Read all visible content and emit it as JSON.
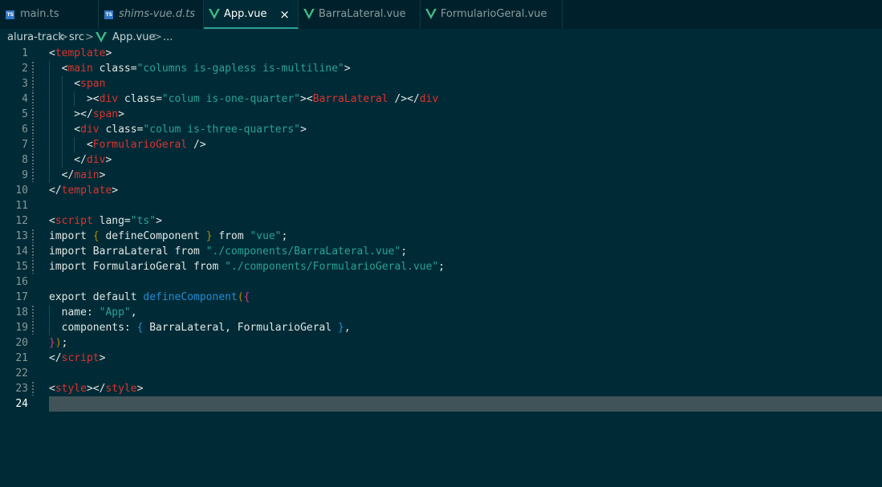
{
  "tabs": [
    {
      "label": "main.ts",
      "icon": "typescript-icon",
      "active": false,
      "italic": false
    },
    {
      "label": "shims-vue.d.ts",
      "icon": "typescript-icon",
      "active": false,
      "italic": true
    },
    {
      "label": "App.vue",
      "icon": "vue-icon",
      "active": true,
      "italic": false,
      "close": "×"
    },
    {
      "label": "BarraLateral.vue",
      "icon": "vue-icon",
      "active": false,
      "italic": false
    },
    {
      "label": "FormularioGeral.vue",
      "icon": "vue-icon",
      "active": false,
      "italic": false
    }
  ],
  "breadcrumb": {
    "items": [
      "alura-track",
      "src",
      "App.vue",
      "..."
    ],
    "separator": ">"
  },
  "editor": {
    "current_line": 24,
    "lines": [
      [
        [
          "p",
          "<"
        ],
        [
          "t",
          "template"
        ],
        [
          "p",
          ">"
        ]
      ],
      [
        [
          "p",
          "  <"
        ],
        [
          "t",
          "main"
        ],
        [
          "a",
          " class="
        ],
        [
          "s",
          "\"columns is-gapless is-multiline\""
        ],
        [
          "p",
          ">"
        ]
      ],
      [
        [
          "p",
          "    <"
        ],
        [
          "t",
          "span"
        ]
      ],
      [
        [
          "p",
          "      ><"
        ],
        [
          "t",
          "div"
        ],
        [
          "a",
          " class="
        ],
        [
          "s",
          "\"colum is-one-quarter\""
        ],
        [
          "p",
          "><"
        ],
        [
          "t",
          "BarraLateral"
        ],
        [
          "p",
          " /></"
        ],
        [
          "t",
          "div"
        ]
      ],
      [
        [
          "p",
          "    ></"
        ],
        [
          "t",
          "span"
        ],
        [
          "p",
          ">"
        ]
      ],
      [
        [
          "p",
          "    <"
        ],
        [
          "t",
          "div"
        ],
        [
          "a",
          " class="
        ],
        [
          "s",
          "\"colum is-three-quarters\""
        ],
        [
          "p",
          ">"
        ]
      ],
      [
        [
          "p",
          "      <"
        ],
        [
          "t",
          "FormularioGeral"
        ],
        [
          "p",
          " />"
        ]
      ],
      [
        [
          "p",
          "    </"
        ],
        [
          "t",
          "div"
        ],
        [
          "p",
          ">"
        ]
      ],
      [
        [
          "p",
          "  </"
        ],
        [
          "t",
          "main"
        ],
        [
          "p",
          ">"
        ]
      ],
      [
        [
          "p",
          "</"
        ],
        [
          "t",
          "template"
        ],
        [
          "p",
          ">"
        ]
      ],
      [],
      [
        [
          "p",
          "<"
        ],
        [
          "t",
          "script"
        ],
        [
          "a",
          " lang="
        ],
        [
          "s",
          "\"ts\""
        ],
        [
          "p",
          ">"
        ]
      ],
      [
        [
          "k",
          "import "
        ],
        [
          "y",
          "{"
        ],
        [
          "c",
          " defineComponent "
        ],
        [
          "y",
          "}"
        ],
        [
          "k",
          " from "
        ],
        [
          "s",
          "\"vue\""
        ],
        [
          "p",
          ";"
        ]
      ],
      [
        [
          "k",
          "import "
        ],
        [
          "c",
          "BarraLateral"
        ],
        [
          "k",
          " from "
        ],
        [
          "s",
          "\"./components/BarraLateral.vue\""
        ],
        [
          "p",
          ";"
        ]
      ],
      [
        [
          "k",
          "import "
        ],
        [
          "c",
          "FormularioGeral"
        ],
        [
          "k",
          " from "
        ],
        [
          "s",
          "\"./components/FormularioGeral.vue\""
        ],
        [
          "p",
          ";"
        ]
      ],
      [],
      [
        [
          "k",
          "export default "
        ],
        [
          "f",
          "defineComponent"
        ],
        [
          "y",
          "("
        ],
        [
          "m",
          "{"
        ]
      ],
      [
        [
          "c",
          "  name: "
        ],
        [
          "s",
          "\"App\""
        ],
        [
          "p",
          ","
        ]
      ],
      [
        [
          "c",
          "  components: "
        ],
        [
          "b",
          "{"
        ],
        [
          "c",
          " BarraLateral, FormularioGeral "
        ],
        [
          "b",
          "}"
        ],
        [
          "p",
          ","
        ]
      ],
      [
        [
          "m",
          "}"
        ],
        [
          "y",
          ")"
        ],
        [
          "p",
          ";"
        ]
      ],
      [
        [
          "p",
          "</"
        ],
        [
          "t",
          "script"
        ],
        [
          "p",
          ">"
        ]
      ],
      [],
      [
        [
          "p",
          "<"
        ],
        [
          "t",
          "style"
        ],
        [
          "p",
          "></"
        ],
        [
          "t",
          "style"
        ],
        [
          "p",
          ">"
        ]
      ],
      []
    ],
    "modified_lines": [
      2,
      3,
      4,
      5,
      6,
      7,
      8,
      9,
      13,
      14,
      15,
      18,
      19,
      23
    ]
  }
}
